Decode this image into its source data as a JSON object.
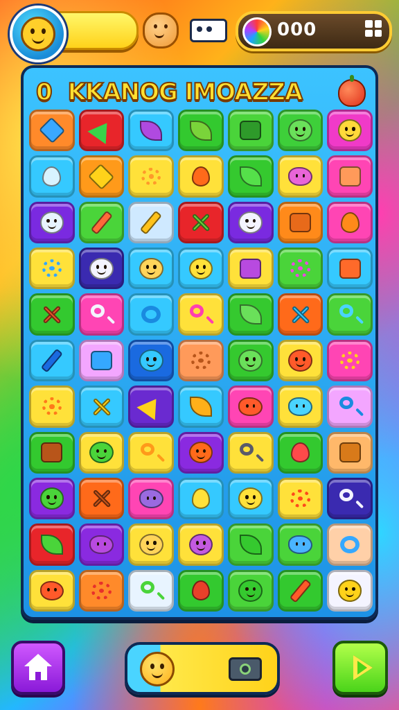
{
  "hud": {
    "coins": "000",
    "avatar_icon": "smiley-sun-icon",
    "profile_icon": "cookie-face-icon",
    "ticket_icon": "ticket-icon",
    "coin_icon": "rainbow-gem-icon",
    "menu_icon": "grid-menu-icon"
  },
  "board": {
    "title_prefix": "0",
    "title": "KKANOG IMOAZZA",
    "title_icon": "apple-icon",
    "columns": 7,
    "rows": 11,
    "tiles": [
      {
        "bg": "#ff8a2a",
        "fg": "#3aa8ff",
        "shape": "diamond",
        "icon": "blue-gem-icon"
      },
      {
        "bg": "#e8252a",
        "fg": "#38d44a",
        "shape": "arrow",
        "icon": "green-arrow-icon"
      },
      {
        "bg": "#35c9ff",
        "fg": "#b04ae0",
        "shape": "leaf",
        "icon": "purple-feather-icon"
      },
      {
        "bg": "#33c92f",
        "fg": "#7ad43a",
        "shape": "leaf",
        "icon": "green-leaf-icon"
      },
      {
        "bg": "#4ad43a",
        "fg": "#2e9a2a",
        "shape": "sq",
        "icon": "dice-icon"
      },
      {
        "bg": "#3ecf3a",
        "fg": "#6ae05a",
        "shape": "face",
        "icon": "green-smiley-icon"
      },
      {
        "bg": "#f03ac8",
        "fg": "#ffd93a",
        "shape": "face",
        "icon": "yellow-smiley-icon"
      },
      {
        "bg": "#35c9ff",
        "fg": "#d8f3ff",
        "shape": "drop",
        "icon": "water-drop-icon"
      },
      {
        "bg": "#ff9a1a",
        "fg": "#ffd21a",
        "shape": "diamond",
        "icon": "gold-gem-icon"
      },
      {
        "bg": "#ffe13a",
        "fg": "#ff9a2a",
        "shape": "gear",
        "icon": "sun-gear-icon"
      },
      {
        "bg": "#ffe13a",
        "fg": "#ff6a1a",
        "shape": "drop",
        "icon": "orange-drop-icon"
      },
      {
        "bg": "#35c92f",
        "fg": "#55e04a",
        "shape": "leaf",
        "icon": "green-pepper-icon"
      },
      {
        "bg": "#ffe13a",
        "fg": "#e865d8",
        "shape": "blob",
        "icon": "pink-blob-icon"
      },
      {
        "bg": "#ff45b4",
        "fg": "#ff9a5a",
        "shape": "sq",
        "icon": "cookie-box-icon"
      },
      {
        "bg": "#7a2ae0",
        "fg": "#e8f4ff",
        "shape": "face",
        "icon": "white-ghost-icon"
      },
      {
        "bg": "#4ad43a",
        "fg": "#ff6a3a",
        "shape": "pencil",
        "icon": "orange-pencil-icon"
      },
      {
        "bg": "#cfe9ff",
        "fg": "#ffc21a",
        "shape": "pencil",
        "icon": "yellow-crayon-icon"
      },
      {
        "bg": "#e8252a",
        "fg": "#6ad43a",
        "shape": "cross",
        "icon": "crossed-sticks-icon"
      },
      {
        "bg": "#7a2ae0",
        "fg": "#f4f4ff",
        "shape": "face",
        "icon": "white-face-icon"
      },
      {
        "bg": "#ff8a1a",
        "fg": "#e86a1a",
        "shape": "sq",
        "icon": "cookie-icon"
      },
      {
        "bg": "#ff45b4",
        "fg": "#ff8a1a",
        "shape": "drop",
        "icon": "orange-fruit-icon"
      },
      {
        "bg": "#ffe13a",
        "fg": "#35a8ff",
        "shape": "gear",
        "icon": "blue-hive-icon"
      },
      {
        "bg": "#3a2ab0",
        "fg": "#f4f4ff",
        "shape": "face",
        "icon": "bear-face-icon"
      },
      {
        "bg": "#35c9ff",
        "fg": "#ffd45a",
        "shape": "face",
        "icon": "cat-face-icon"
      },
      {
        "bg": "#35c9ff",
        "fg": "#ffe13a",
        "shape": "face",
        "icon": "yellow-bird-icon"
      },
      {
        "bg": "#ffe13a",
        "fg": "#b84ae0",
        "shape": "sq",
        "icon": "battery-icon"
      },
      {
        "bg": "#4ad43a",
        "fg": "#e84ae0",
        "shape": "gear",
        "icon": "pink-gear-icon"
      },
      {
        "bg": "#35c9ff",
        "fg": "#ff6a2a",
        "shape": "sq",
        "icon": "treasure-chest-icon"
      },
      {
        "bg": "#33c92f",
        "fg": "#e8552a",
        "shape": "cross",
        "icon": "crossed-swords-icon"
      },
      {
        "bg": "#ff45b4",
        "fg": "#f4f4ff",
        "shape": "mag",
        "icon": "magnifier-icon"
      },
      {
        "bg": "#35c9ff",
        "fg": "#1a8ae0",
        "shape": "ring",
        "icon": "blue-hook-icon"
      },
      {
        "bg": "#ffe13a",
        "fg": "#ff3fb0",
        "shape": "mag",
        "icon": "pink-magnifier-icon"
      },
      {
        "bg": "#35c92f",
        "fg": "#6ae05a",
        "shape": "leaf",
        "icon": "green-feather-icon"
      },
      {
        "bg": "#ff6a1a",
        "fg": "#35c9ff",
        "shape": "cross",
        "icon": "crossed-pencils-icon"
      },
      {
        "bg": "#4ad43a",
        "fg": "#4ad4ff",
        "shape": "mag",
        "icon": "blue-lollipop-icon"
      },
      {
        "bg": "#35c9ff",
        "fg": "#1a6ae0",
        "shape": "pencil",
        "icon": "blue-bottle-icon"
      },
      {
        "bg": "#f3a6ff",
        "fg": "#35a8ff",
        "shape": "sq",
        "icon": "blue-crate-icon"
      },
      {
        "bg": "#1a6ae0",
        "fg": "#35c9ff",
        "shape": "face",
        "icon": "blue-smiley-icon"
      },
      {
        "bg": "#ff9a5a",
        "fg": "#b8551a",
        "shape": "gear",
        "icon": "berry-cluster-icon"
      },
      {
        "bg": "#35c92f",
        "fg": "#6ae05a",
        "shape": "face",
        "icon": "green-blob-icon"
      },
      {
        "bg": "#ffe13a",
        "fg": "#ff5a2a",
        "shape": "face",
        "icon": "red-smiley-icon"
      },
      {
        "bg": "#ff45b4",
        "fg": "#ffd21a",
        "shape": "gear",
        "icon": "yellow-star-icon"
      },
      {
        "bg": "#ffe13a",
        "fg": "#ff7a1a",
        "shape": "gear",
        "icon": "orange-gear-icon"
      },
      {
        "bg": "#35c9ff",
        "fg": "#ffd21a",
        "shape": "cross",
        "icon": "yellow-cross-icon"
      },
      {
        "bg": "#6a2ad0",
        "fg": "#ffd21a",
        "shape": "arrow",
        "icon": "yellow-kite-icon"
      },
      {
        "bg": "#35c9ff",
        "fg": "#ffb01a",
        "shape": "leaf",
        "icon": "seashell-icon"
      },
      {
        "bg": "#ff45b4",
        "fg": "#ff5a2a",
        "shape": "blob",
        "icon": "red-fish-icon"
      },
      {
        "bg": "#ffe13a",
        "fg": "#4ad4ff",
        "shape": "blob",
        "icon": "blue-bug-icon"
      },
      {
        "bg": "#f3a6ff",
        "fg": "#1a8ae0",
        "shape": "mag",
        "icon": "blue-spoon-icon"
      },
      {
        "bg": "#33c92f",
        "fg": "#b8551a",
        "shape": "sq",
        "icon": "wooden-crate-icon"
      },
      {
        "bg": "#ffe13a",
        "fg": "#4ad43a",
        "shape": "face",
        "icon": "green-cube-face-icon"
      },
      {
        "bg": "#ffe13a",
        "fg": "#ff9a1a",
        "shape": "mag",
        "icon": "orange-magnifier-icon"
      },
      {
        "bg": "#8a2ae0",
        "fg": "#ff6a1a",
        "shape": "face",
        "icon": "orange-monkey-icon"
      },
      {
        "bg": "#ffe13a",
        "fg": "#5a5a6a",
        "shape": "mag",
        "icon": "gray-magnifier-icon"
      },
      {
        "bg": "#33c92f",
        "fg": "#ff4a4a",
        "shape": "drop",
        "icon": "watermelon-icon"
      },
      {
        "bg": "#ffb86a",
        "fg": "#d87a1a",
        "shape": "sq",
        "icon": "toy-block-icon"
      },
      {
        "bg": "#8a2ae0",
        "fg": "#4ad43a",
        "shape": "face",
        "icon": "green-ball-face-icon"
      },
      {
        "bg": "#ff6a1a",
        "fg": "#c8551a",
        "shape": "cross",
        "icon": "crossed-bones-icon"
      },
      {
        "bg": "#ff45b4",
        "fg": "#9a6ae0",
        "shape": "blob",
        "icon": "purple-blob-icon"
      },
      {
        "bg": "#35c9ff",
        "fg": "#ffe13a",
        "shape": "drop",
        "icon": "yellow-egg-icon"
      },
      {
        "bg": "#35c9ff",
        "fg": "#ffe13a",
        "shape": "face",
        "icon": "yellow-face-icon"
      },
      {
        "bg": "#ffe13a",
        "fg": "#ff4a1a",
        "shape": "gear",
        "icon": "red-spiky-icon"
      },
      {
        "bg": "#3a2ab0",
        "fg": "#f4f4ff",
        "shape": "mag",
        "icon": "white-rattle-icon"
      },
      {
        "bg": "#e8252a",
        "fg": "#4ad43a",
        "shape": "leaf",
        "icon": "green-leaf-tile-icon"
      },
      {
        "bg": "#8a2ae0",
        "fg": "#b84ae0",
        "shape": "blob",
        "icon": "purple-monster-icon"
      },
      {
        "bg": "#ffe13a",
        "fg": "#ffd45a",
        "shape": "face",
        "icon": "yellow-chick-icon"
      },
      {
        "bg": "#ffe13a",
        "fg": "#c45ae0",
        "shape": "face",
        "icon": "purple-creature-icon"
      },
      {
        "bg": "#4ad43a",
        "fg": "#35c92f",
        "shape": "leaf",
        "icon": "dark-leaf-icon"
      },
      {
        "bg": "#4ad43a",
        "fg": "#4ab4ff",
        "shape": "blob",
        "icon": "blue-bird-icon"
      },
      {
        "bg": "#ffd0a8",
        "fg": "#35a8ff",
        "shape": "ring",
        "icon": "globe-icon"
      },
      {
        "bg": "#ffe13a",
        "fg": "#ff5a2a",
        "shape": "blob",
        "icon": "red-bean-icon"
      },
      {
        "bg": "#ff8a2a",
        "fg": "#e8302a",
        "shape": "gear",
        "icon": "red-burst-icon"
      },
      {
        "bg": "#e8f4ff",
        "fg": "#4ad43a",
        "shape": "mag",
        "icon": "green-speech-bubble-icon"
      },
      {
        "bg": "#33c92f",
        "fg": "#e8402a",
        "shape": "drop",
        "icon": "red-apple-icon"
      },
      {
        "bg": "#4ad43a",
        "fg": "#35c92f",
        "shape": "face",
        "icon": "green-smile-icon"
      },
      {
        "bg": "#33c92f",
        "fg": "#ff5a2a",
        "shape": "pencil",
        "icon": "red-crayon-icon"
      },
      {
        "bg": "#f4f4ff",
        "fg": "#ffd21a",
        "shape": "face",
        "icon": "golden-face-icon"
      }
    ]
  },
  "footer": {
    "home_icon": "home-icon",
    "power_icon": "sun-face-icon",
    "camera_icon": "camera-icon",
    "play_icon": "play-icon"
  }
}
